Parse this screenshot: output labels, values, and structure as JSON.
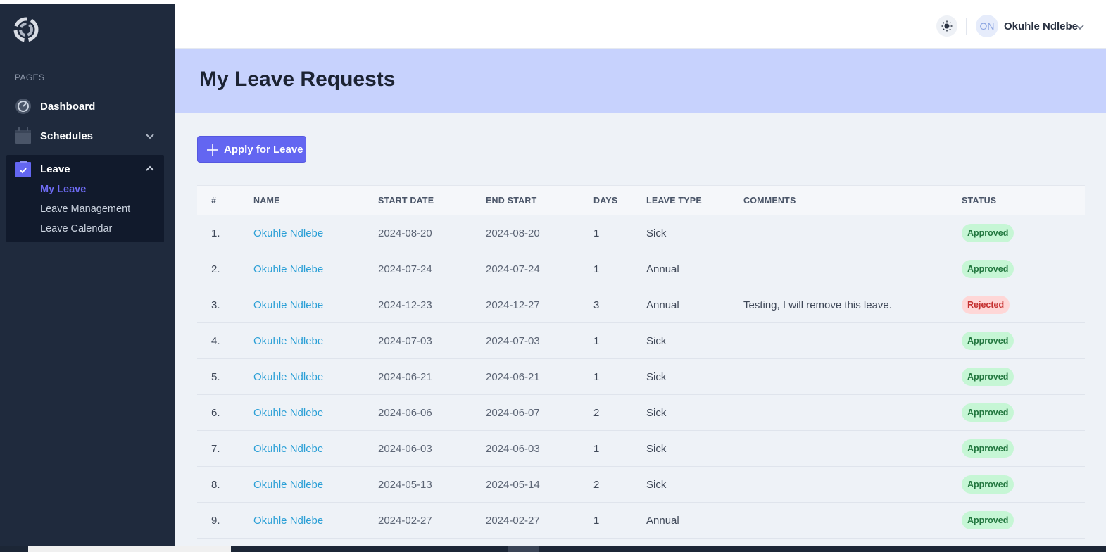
{
  "sidebar": {
    "section_heading": "PAGES",
    "items": [
      {
        "label": "Dashboard",
        "icon": "dashboard-icon"
      },
      {
        "label": "Schedules",
        "icon": "calendar-icon"
      },
      {
        "label": "Leave",
        "icon": "clipboard-check-icon"
      }
    ],
    "leave_submenu": [
      {
        "label": "My Leave",
        "active": true
      },
      {
        "label": "Leave Management",
        "active": false
      },
      {
        "label": "Leave Calendar",
        "active": false
      }
    ]
  },
  "header": {
    "theme_icon": "sun-icon",
    "avatar_initials": "ON",
    "user_name": "Okuhle Ndlebe"
  },
  "page": {
    "title": "My Leave Requests",
    "apply_button": "Apply for Leave"
  },
  "table": {
    "columns": [
      "#",
      "NAME",
      "START DATE",
      "END START",
      "DAYS",
      "LEAVE TYPE",
      "COMMENTS",
      "STATUS"
    ],
    "rows": [
      {
        "num": "1.",
        "name": "Okuhle Ndlebe",
        "start": "2024-08-20",
        "end": "2024-08-20",
        "days": "1",
        "type": "Sick",
        "comments": "",
        "status": "Approved"
      },
      {
        "num": "2.",
        "name": "Okuhle Ndlebe",
        "start": "2024-07-24",
        "end": "2024-07-24",
        "days": "1",
        "type": "Annual",
        "comments": "",
        "status": "Approved"
      },
      {
        "num": "3.",
        "name": "Okuhle Ndlebe",
        "start": "2024-12-23",
        "end": "2024-12-27",
        "days": "3",
        "type": "Annual",
        "comments": "Testing, I will remove this leave.",
        "status": "Rejected"
      },
      {
        "num": "4.",
        "name": "Okuhle Ndlebe",
        "start": "2024-07-03",
        "end": "2024-07-03",
        "days": "1",
        "type": "Sick",
        "comments": "",
        "status": "Approved"
      },
      {
        "num": "5.",
        "name": "Okuhle Ndlebe",
        "start": "2024-06-21",
        "end": "2024-06-21",
        "days": "1",
        "type": "Sick",
        "comments": "",
        "status": "Approved"
      },
      {
        "num": "6.",
        "name": "Okuhle Ndlebe",
        "start": "2024-06-06",
        "end": "2024-06-07",
        "days": "2",
        "type": "Sick",
        "comments": "",
        "status": "Approved"
      },
      {
        "num": "7.",
        "name": "Okuhle Ndlebe",
        "start": "2024-06-03",
        "end": "2024-06-03",
        "days": "1",
        "type": "Sick",
        "comments": "",
        "status": "Approved"
      },
      {
        "num": "8.",
        "name": "Okuhle Ndlebe",
        "start": "2024-05-13",
        "end": "2024-05-14",
        "days": "2",
        "type": "Sick",
        "comments": "",
        "status": "Approved"
      },
      {
        "num": "9.",
        "name": "Okuhle Ndlebe",
        "start": "2024-02-27",
        "end": "2024-02-27",
        "days": "1",
        "type": "Annual",
        "comments": "",
        "status": "Approved"
      }
    ]
  },
  "colors": {
    "sidebar_bg": "#1f2a3d",
    "accent": "#6366f1",
    "banner_bg": "#c7d2fd",
    "link": "#2a9fd6",
    "approved_bg": "#c6f6d5",
    "rejected_bg": "#fed7d7"
  }
}
